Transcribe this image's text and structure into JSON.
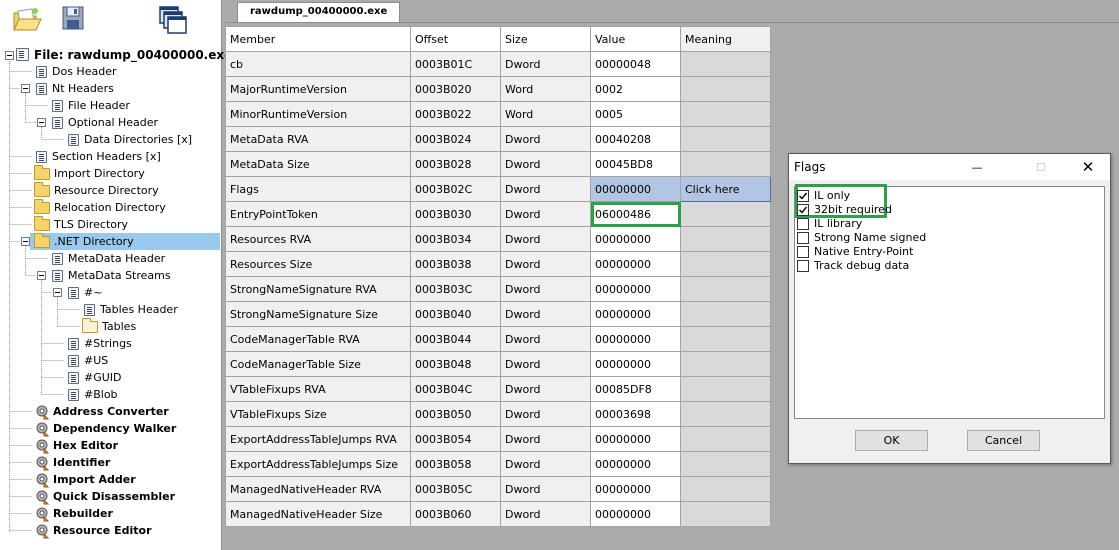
{
  "app": {
    "toolbar": {
      "icons": [
        "open-file-icon",
        "save-file-icon",
        "windows-icon"
      ]
    }
  },
  "tree": {
    "root": "File: rawdump_00400000.exe",
    "items": [
      {
        "label": "Dos Header",
        "icon": "page-icon"
      },
      {
        "label": "Nt Headers",
        "icon": "page-icon"
      },
      {
        "label": "File Header",
        "icon": "page-icon"
      },
      {
        "label": "Optional Header",
        "icon": "page-icon"
      },
      {
        "label": "Data Directories [x]",
        "icon": "page-icon"
      },
      {
        "label": "Section Headers [x]",
        "icon": "page-icon"
      },
      {
        "label": "Import Directory",
        "icon": "folder-icon"
      },
      {
        "label": "Resource Directory",
        "icon": "folder-icon"
      },
      {
        "label": "Relocation Directory",
        "icon": "folder-icon"
      },
      {
        "label": "TLS Directory",
        "icon": "folder-icon"
      },
      {
        "label": ".NET Directory",
        "icon": "folder-icon"
      },
      {
        "label": "MetaData Header",
        "icon": "page-icon"
      },
      {
        "label": "MetaData Streams",
        "icon": "page-icon"
      },
      {
        "label": "#~",
        "icon": "page-icon"
      },
      {
        "label": "Tables Header",
        "icon": "page-icon"
      },
      {
        "label": "Tables",
        "icon": "folder-icon"
      },
      {
        "label": "#Strings",
        "icon": "page-icon"
      },
      {
        "label": "#US",
        "icon": "page-icon"
      },
      {
        "label": "#GUID",
        "icon": "page-icon"
      },
      {
        "label": "#Blob",
        "icon": "page-icon"
      }
    ],
    "tools": [
      "Address Converter",
      "Dependency Walker",
      "Hex Editor",
      "Identifier",
      "Import Adder",
      "Quick Disassembler",
      "Rebuilder",
      "Resource Editor"
    ],
    "selected": ".NET Directory"
  },
  "tab": {
    "label": "rawdump_00400000.exe"
  },
  "grid": {
    "columns": [
      "Member",
      "Offset",
      "Size",
      "Value",
      "Meaning"
    ],
    "rows": [
      [
        "cb",
        "0003B01C",
        "Dword",
        "00000048",
        ""
      ],
      [
        "MajorRuntimeVersion",
        "0003B020",
        "Word",
        "0002",
        ""
      ],
      [
        "MinorRuntimeVersion",
        "0003B022",
        "Word",
        "0005",
        ""
      ],
      [
        "MetaData RVA",
        "0003B024",
        "Dword",
        "00040208",
        ""
      ],
      [
        "MetaData Size",
        "0003B028",
        "Dword",
        "00045BD8",
        ""
      ],
      [
        "Flags",
        "0003B02C",
        "Dword",
        "00000000",
        "Click here"
      ],
      [
        "EntryPointToken",
        "0003B030",
        "Dword",
        "06000486",
        ""
      ],
      [
        "Resources RVA",
        "0003B034",
        "Dword",
        "00000000",
        ""
      ],
      [
        "Resources Size",
        "0003B038",
        "Dword",
        "00000000",
        ""
      ],
      [
        "StrongNameSignature RVA",
        "0003B03C",
        "Dword",
        "00000000",
        ""
      ],
      [
        "StrongNameSignature Size",
        "0003B040",
        "Dword",
        "00000000",
        ""
      ],
      [
        "CodeManagerTable RVA",
        "0003B044",
        "Dword",
        "00000000",
        ""
      ],
      [
        "CodeManagerTable Size",
        "0003B048",
        "Dword",
        "00000000",
        ""
      ],
      [
        "VTableFixups RVA",
        "0003B04C",
        "Dword",
        "00085DF8",
        ""
      ],
      [
        "VTableFixups Size",
        "0003B050",
        "Dword",
        "00003698",
        ""
      ],
      [
        "ExportAddressTableJumps RVA",
        "0003B054",
        "Dword",
        "00000000",
        ""
      ],
      [
        "ExportAddressTableJumps Size",
        "0003B058",
        "Dword",
        "00000000",
        ""
      ],
      [
        "ManagedNativeHeader RVA",
        "0003B05C",
        "Dword",
        "00000000",
        ""
      ],
      [
        "ManagedNativeHeader Size",
        "0003B060",
        "Dword",
        "00000000",
        ""
      ]
    ],
    "selected_row": "Flags",
    "highlighted_value": "06000486"
  },
  "dialog": {
    "title": "Flags",
    "controls": {
      "minimize": "—",
      "maximize": "☐",
      "close": "✕"
    },
    "flags": [
      {
        "label": "IL only",
        "checked": true
      },
      {
        "label": "32bit required",
        "checked": true
      },
      {
        "label": "IL library",
        "checked": false
      },
      {
        "label": "Strong Name signed",
        "checked": false
      },
      {
        "label": "Native Entry-Point",
        "checked": false
      },
      {
        "label": "Track debug data",
        "checked": false
      }
    ],
    "ok_label": "OK",
    "cancel_label": "Cancel"
  },
  "colors": {
    "highlight_green": "#2ba148",
    "selection_blue": "#99c9ef",
    "grid_selection": "#b2c6e4",
    "workspace_gray": "#ababab"
  }
}
